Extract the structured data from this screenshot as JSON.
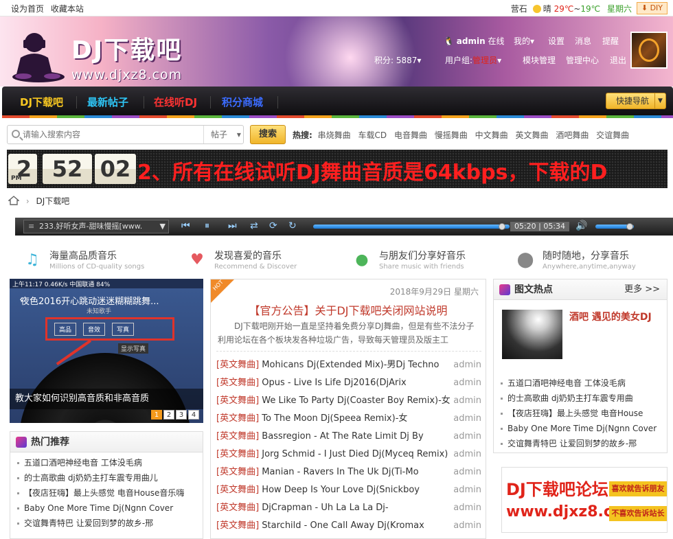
{
  "topbar": {
    "set_home": "设为首页",
    "bookmark": "收藏本站",
    "city": "营石",
    "weather": "晴",
    "temp_high": "29℃",
    "tilde": "~",
    "temp_low": "19℃",
    "weekday": "星期六",
    "diy": "DIY"
  },
  "logo": {
    "title": "DJ下载吧",
    "url": "www.djxz8.com"
  },
  "user": {
    "name": "admin",
    "status": "在线",
    "mine": "我的",
    "settings": "设置",
    "messages": "消息",
    "remind": "提醒",
    "points_label": "积分:",
    "points": "5887",
    "group_label": "用户组:",
    "group": "管理员",
    "module_mgmt": "模块管理",
    "admin_center": "管理中心",
    "logout": "退出"
  },
  "nav": {
    "items": [
      "DJ下载吧",
      "最新帖子",
      "在线听DJ",
      "积分商城"
    ],
    "colors": [
      "#f9c821",
      "#2ec4f4",
      "#ff3333",
      "#3b6cff"
    ],
    "quick": "快捷导航"
  },
  "search": {
    "placeholder": "请输入搜索内容",
    "scope": "帖子",
    "button": "搜索",
    "hot_label": "热搜:",
    "hot": [
      "串烧舞曲",
      "车载CD",
      "电音舞曲",
      "慢摇舞曲",
      "中文舞曲",
      "英文舞曲",
      "酒吧舞曲",
      "交谊舞曲"
    ]
  },
  "ticker": {
    "hh": "2",
    "mm": "52",
    "ss": "02",
    "ampm": "PM",
    "message": "2、所有在线试听DJ舞曲音质是64kbps，下载的D"
  },
  "breadcrumb": {
    "current": "DJ下载吧"
  },
  "player": {
    "track": "233.好听女声-甜味慢摇[www.",
    "time": "05:20 | 05:34",
    "progress": 0.96,
    "volume": 0.9
  },
  "features": [
    {
      "title": "海量高品质音乐",
      "sub": "Millions of CD-quality songs",
      "icon": "music-note-icon",
      "color": "#3fb5d9"
    },
    {
      "title": "发现喜爱的音乐",
      "sub": "Recommend & Discover",
      "icon": "heart-icon",
      "color": "#e5595f"
    },
    {
      "title": "与朋友们分享好音乐",
      "sub": "Share music with friends",
      "icon": "chat-icon",
      "color": "#4db55a"
    },
    {
      "title": "随时随地，分享音乐",
      "sub": "Anywhere,anytime,anyway",
      "icon": "location-icon",
      "color": "#888888"
    }
  ],
  "slider": {
    "status": "上午11:17  0.46K/s  中国联通  84%",
    "song": "夜色2016开心跳动迷迷糊糊跳舞...",
    "artist": "未知歌手",
    "tabs": [
      "高品",
      "音效",
      "写真"
    ],
    "tip": "显示写真",
    "caption": "教大家如何识别高音质和非高音质",
    "pages": [
      "1",
      "2",
      "3",
      "4"
    ]
  },
  "recommend": {
    "title": "热门推荐",
    "items": [
      "五道口酒吧神经电音 工体没毛病",
      "的士高歌曲 dj奶奶主打车震专用曲儿",
      "【夜店狂嗨】最上头感觉 电音House音乐嗨",
      "Baby One More Time Dj(Ngnn Cover",
      "交谊舞青特巴 让爱回到梦的故乡-邢"
    ]
  },
  "announcement": {
    "badge": "HOT",
    "date": "2018年9月29日 星期六",
    "title": "【官方公告】关于DJ下载吧关闭网站说明",
    "desc": "DJ下载吧刚开始一直是坚持着免费分享DJ舞曲，但是有些不法分子利用论坛在各个板块发各种垃圾广告，导致每天管理员及版主工"
  },
  "threads": [
    {
      "cat": "[英文舞曲]",
      "title": "Mohicans Dj(Extended Mix)-男Dj Techno",
      "author": "admin"
    },
    {
      "cat": "[英文舞曲]",
      "title": "Opus - Live Is Life Dj2016(DjArix",
      "author": "admin"
    },
    {
      "cat": "[英文舞曲]",
      "title": "We Like To Party Dj(Coaster Boy Remix)-女",
      "author": "admin"
    },
    {
      "cat": "[英文舞曲]",
      "title": "To The Moon Dj(Speea Remix)-女",
      "author": "admin"
    },
    {
      "cat": "[英文舞曲]",
      "title": "Bassregion - At The Rate Limit Dj By",
      "author": "admin"
    },
    {
      "cat": "[英文舞曲]",
      "title": "Jorg Schmid - I Just Died Dj(Myceq Remix)",
      "author": "admin"
    },
    {
      "cat": "[英文舞曲]",
      "title": "Manian - Ravers In The Uk Dj(Ti-Mo",
      "author": "admin"
    },
    {
      "cat": "[英文舞曲]",
      "title": "How Deep Is Your Love Dj(Snickboy",
      "author": "admin"
    },
    {
      "cat": "[英文舞曲]",
      "title": "DjCrapman - Uh La La La Dj-",
      "author": "admin"
    },
    {
      "cat": "[英文舞曲]",
      "title": "Starchild - One Call Away Dj(Kromax",
      "author": "admin"
    }
  ],
  "picnews": {
    "title": "图文热点",
    "more": "更多 >>",
    "pic_title": "酒吧 遇见的美女DJ",
    "items": [
      "五道口酒吧神经电音 工体没毛病",
      "的士高歌曲 dj奶奶主打车震专用曲",
      "【夜店狂嗨】最上头感觉 电音House",
      "Baby One More Time Dj(Ngnn Cover",
      "交谊舞青特巴 让爱回到梦的故乡-邢"
    ]
  },
  "ad": {
    "line1": "DJ下载吧论坛",
    "line2": "www.djxz8.com",
    "btn1": "喜欢就告诉朋友",
    "btn2": "不喜欢告诉站长"
  }
}
